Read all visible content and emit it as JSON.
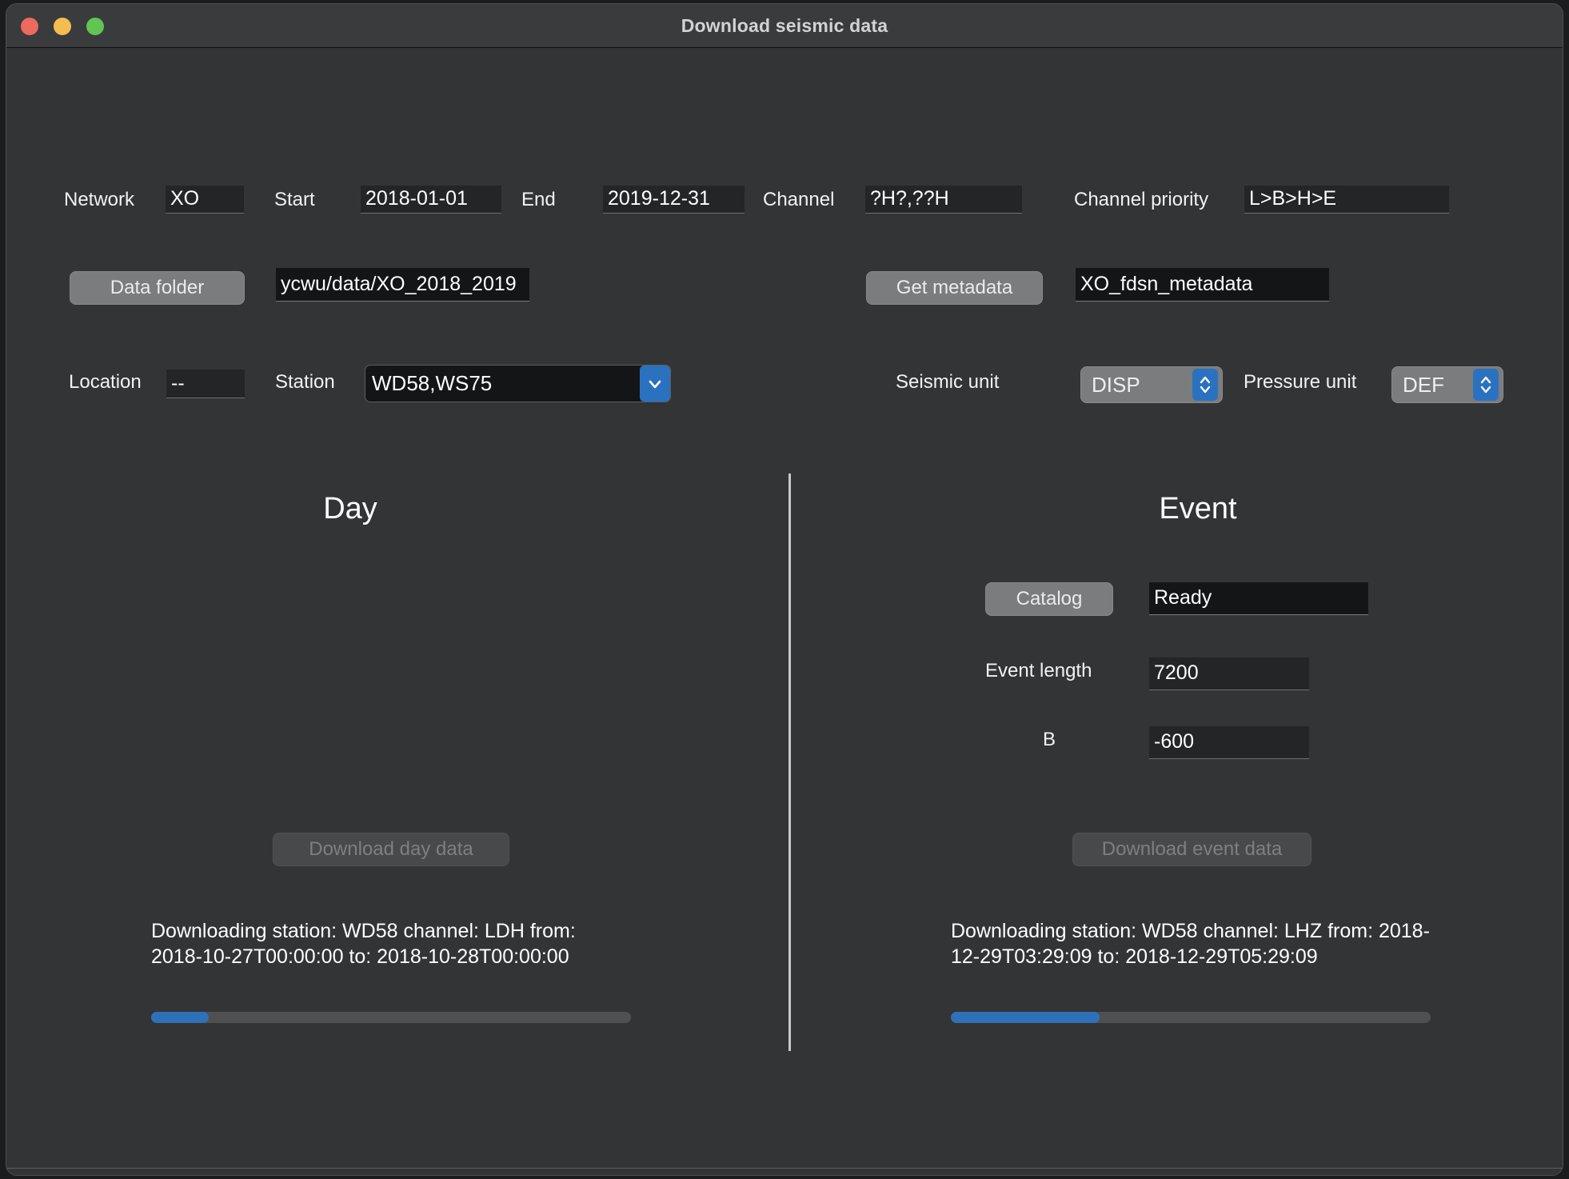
{
  "window": {
    "title": "Download seismic data",
    "traffic_lights": [
      "close-button",
      "minimize-button",
      "zoom-button"
    ],
    "colors": {
      "close": "#ed6a5f",
      "minimize": "#f5bd4f",
      "zoom": "#61c554",
      "accent": "#2a72c0",
      "progress_fill": "#2d72b8",
      "background": "#333436",
      "titlebar": "#3a3b3d"
    }
  },
  "top_form": {
    "network": {
      "label": "Network",
      "value": "XO"
    },
    "start": {
      "label": "Start",
      "value": "2018-01-01"
    },
    "end": {
      "label": "End",
      "value": "2019-12-31"
    },
    "channel": {
      "label": "Channel",
      "value": "?H?,??H"
    },
    "channel_priority": {
      "label": "Channel priority",
      "value": "L>B>H>E"
    },
    "data_folder_button": "Data folder",
    "data_folder_value": "ycwu/data/XO_2018_2019",
    "get_metadata_button": "Get metadata",
    "metadata_value": "XO_fdsn_metadata",
    "location": {
      "label": "Location",
      "value": "--"
    },
    "station": {
      "label": "Station",
      "value": "WD58,WS75"
    },
    "seismic_unit": {
      "label": "Seismic unit",
      "value": "DISP"
    },
    "pressure_unit": {
      "label": "Pressure unit",
      "value": "DEF"
    }
  },
  "day_panel": {
    "title": "Day",
    "download_button": "Download day data",
    "status": "Downloading station: WD58 channel: LDH from: 2018-10-27T00:00:00 to: 2018-10-28T00:00:00",
    "progress_percent": 12
  },
  "event_panel": {
    "title": "Event",
    "catalog_button": "Catalog",
    "catalog_status": "Ready",
    "event_length": {
      "label": "Event length",
      "value": "7200"
    },
    "b": {
      "label": "B",
      "value": "-600"
    },
    "download_button": "Download event data",
    "status": "Downloading station: WD58 channel: LHZ from: 2018-12-29T03:29:09 to: 2018-12-29T05:29:09",
    "progress_percent": 31
  }
}
